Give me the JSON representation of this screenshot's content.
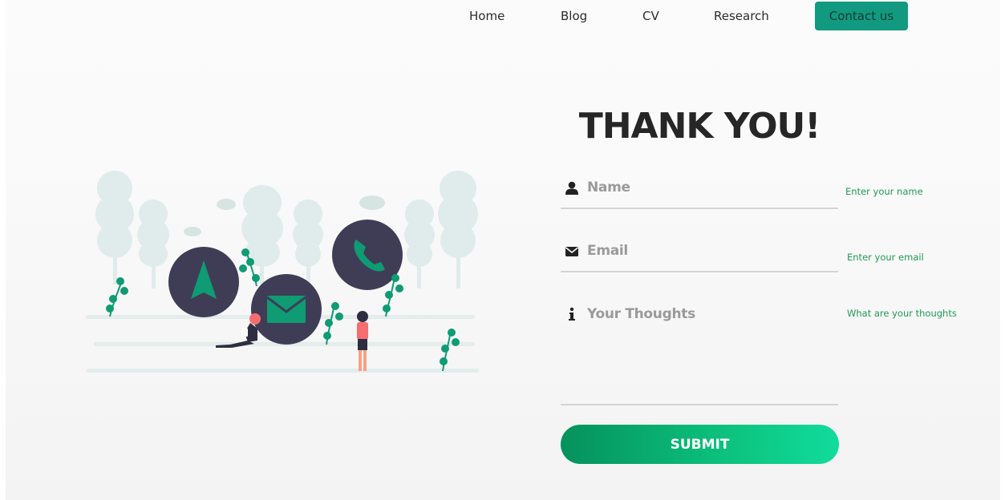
{
  "nav": {
    "items": [
      {
        "label": "Home"
      },
      {
        "label": "Blog"
      },
      {
        "label": "CV"
      },
      {
        "label": "Research"
      }
    ],
    "contact_label": "Contact us"
  },
  "heading": "THANK YOU!",
  "form": {
    "name": {
      "placeholder": "Name",
      "hint": "Enter your name",
      "icon": "user-icon"
    },
    "email": {
      "placeholder": "Email",
      "hint": "Enter your email",
      "icon": "envelope-icon"
    },
    "thoughts": {
      "placeholder": "Your Thoughts",
      "hint": "What are your thoughts",
      "icon": "info-icon"
    },
    "submit_label": "SUBMIT"
  },
  "colors": {
    "accent": "#129a80",
    "hint": "#1f9a55",
    "illustration_circles": "#3f3d56",
    "illustration_green": "#0f9b73"
  },
  "illustration": {
    "icons": [
      "navigation-arrow-icon",
      "envelope-icon",
      "phone-icon"
    ]
  }
}
